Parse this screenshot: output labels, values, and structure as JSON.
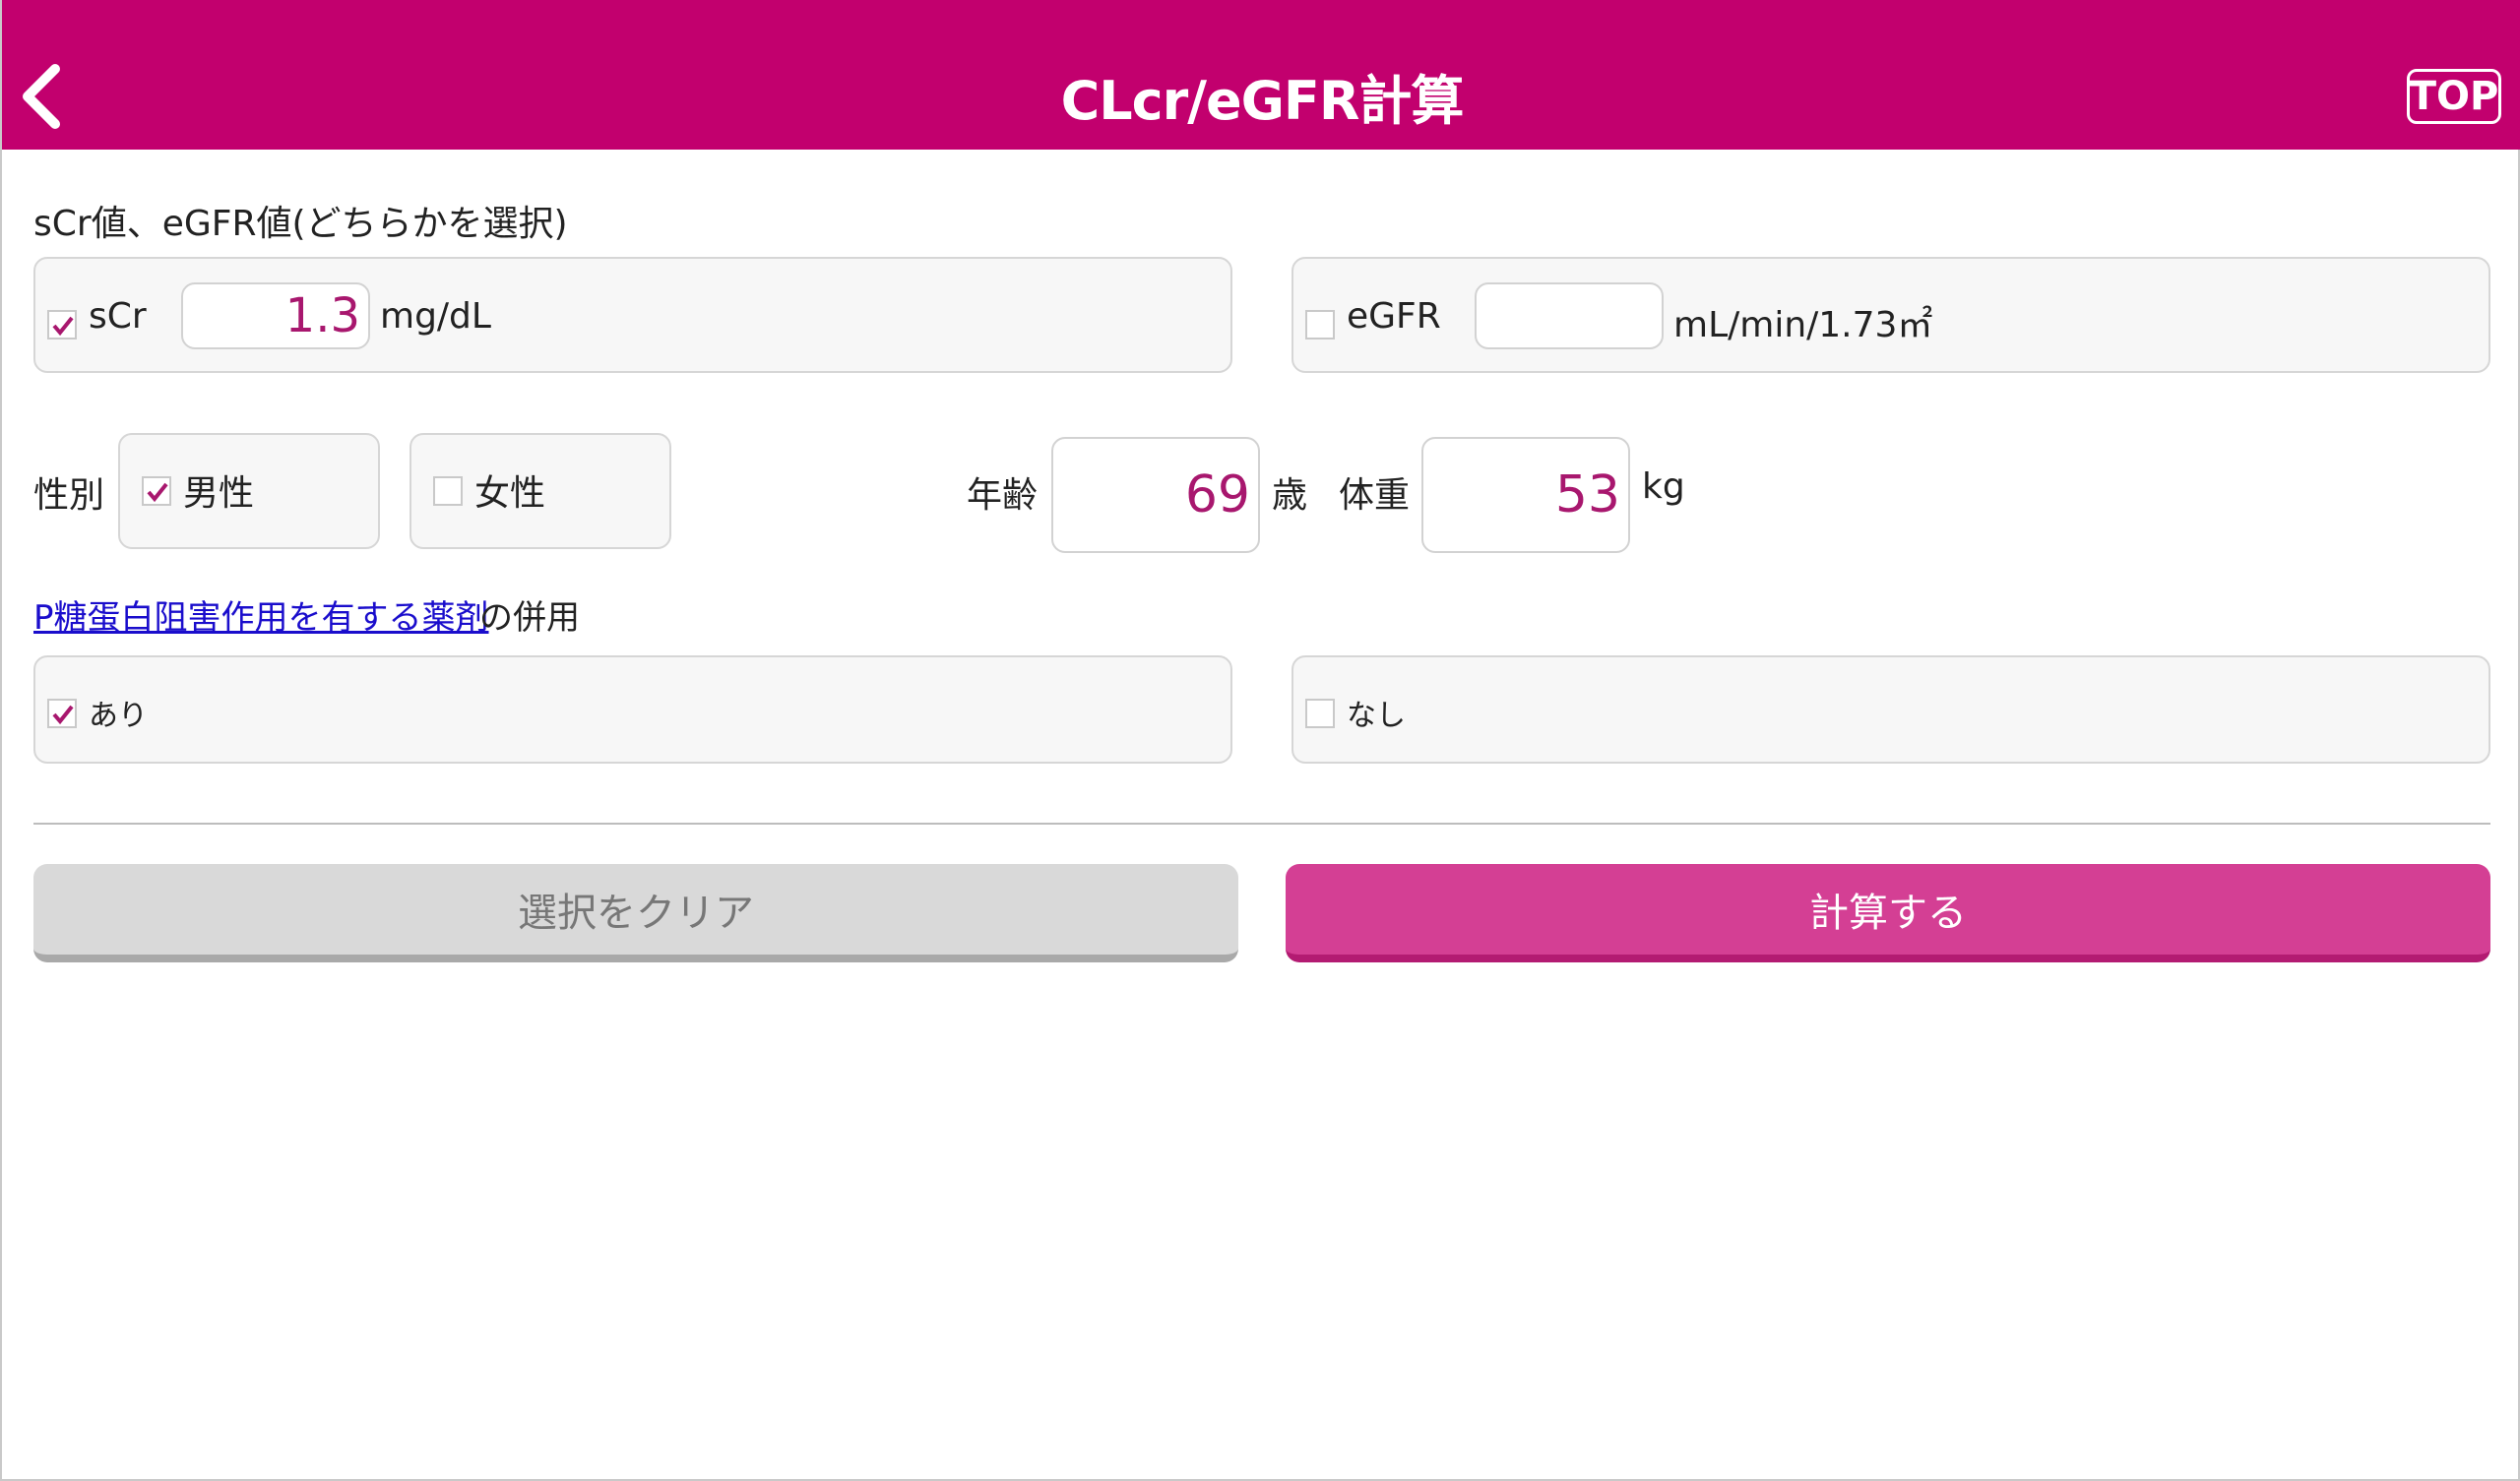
{
  "header": {
    "title": "CLcr/eGFR計算",
    "top_label": "TOP"
  },
  "renal": {
    "section_label": "sCr値、eGFR値(どちらかを選択)",
    "scr": {
      "label": "sCr",
      "value": "1.3",
      "unit": "mg/dL",
      "checked": true
    },
    "egfr": {
      "label": "eGFR",
      "value": "",
      "unit": "mL/min/1.73㎡",
      "checked": false
    }
  },
  "sex": {
    "label": "性別",
    "male": {
      "label": "男性",
      "checked": true
    },
    "female": {
      "label": "女性",
      "checked": false
    }
  },
  "age": {
    "label": "年齢",
    "value": "69",
    "unit": "歳"
  },
  "weight": {
    "label": "体重",
    "value": "53",
    "unit": "kg"
  },
  "pgp": {
    "link_text": "P糖蛋白阻害作用を有する薬剤",
    "suffix": "の併用",
    "yes": {
      "label": "あり",
      "checked": true
    },
    "no": {
      "label": "なし",
      "checked": false
    }
  },
  "buttons": {
    "clear_label": "選択をクリア",
    "calc_label": "計算する"
  },
  "colors": {
    "brand": "#c2006e",
    "calc_button": "#d43f94",
    "value_text": "#a8176e",
    "link": "#1a0dcc"
  }
}
